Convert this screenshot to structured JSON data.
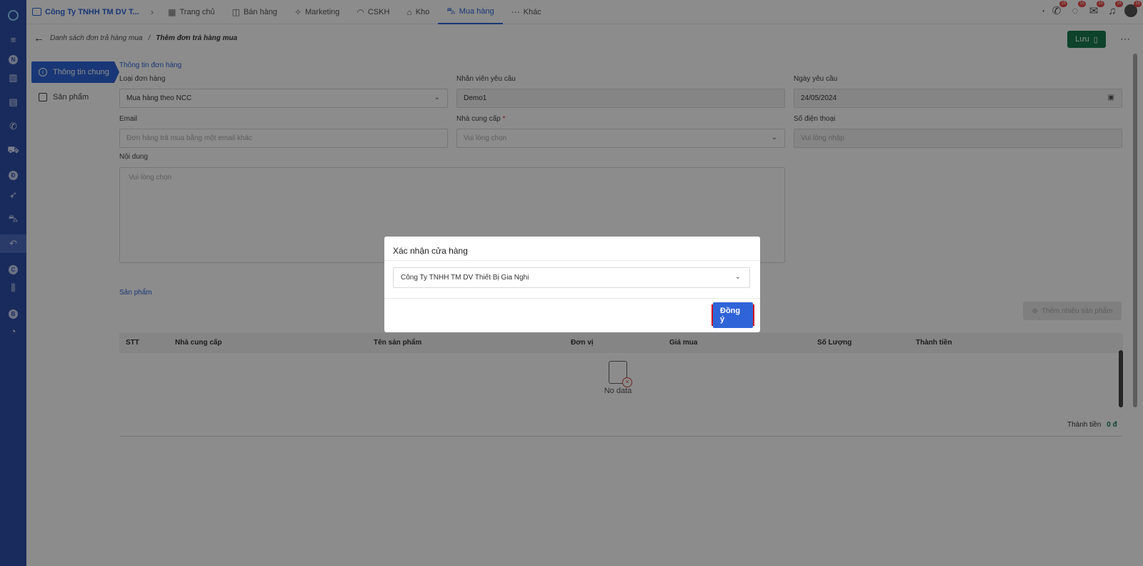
{
  "top_nav": {
    "store": "Công Ty TNHH TM DV T...",
    "items": [
      {
        "label": "Trang chủ",
        "icon": "chart-icon"
      },
      {
        "label": "Bán hàng",
        "icon": "box-icon"
      },
      {
        "label": "Marketing",
        "icon": "megaphone-icon"
      },
      {
        "label": "CSKH",
        "icon": "handshake-icon"
      },
      {
        "label": "Kho",
        "icon": "warehouse-icon"
      },
      {
        "label": "Mua hàng",
        "icon": "cart-icon"
      },
      {
        "label": "Khác",
        "icon": "dots-icon"
      }
    ],
    "badges": [
      "15",
      "15",
      "15",
      "15",
      "15"
    ]
  },
  "breadcrumb": {
    "parent": "Danh sách đơn trả hàng mua",
    "separator": "/",
    "current": "Thêm đơn trả hàng mua"
  },
  "save_label": "Lưu",
  "side_tabs": [
    "Thông tin chung",
    "Sản phẩm"
  ],
  "sidebar_letters": [
    "N",
    "Đ",
    "C",
    "B"
  ],
  "form": {
    "section_title": "Thông tin đơn hàng",
    "order_type": {
      "label": "Loại đơn hàng",
      "value": "Mua hàng theo NCC"
    },
    "requester": {
      "label": "Nhân viên yêu cầu",
      "value": "Demo1"
    },
    "request_date": {
      "label": "Ngày yêu cầu",
      "value": "24/05/2024"
    },
    "email": {
      "label": "Email",
      "placeholder": "Đơn hàng trả mua bằng một email khác"
    },
    "supplier": {
      "label": "Nhà cung cấp",
      "required": "*",
      "placeholder": "Vui lòng chọn"
    },
    "phone": {
      "label": "Số điện thoại",
      "placeholder": "Vui lòng nhập"
    },
    "content": {
      "label": "Nội dung",
      "placeholder": "Vui lòng chọn"
    }
  },
  "products": {
    "section_title": "Sản phẩm",
    "add_many": "Thêm nhiều sản phẩm",
    "columns": [
      "STT",
      "Nhà cung cấp",
      "Tên sản phẩm",
      "Đơn vị",
      "Giá mua",
      "Số Lượng",
      "Thành tiền"
    ],
    "empty": "No data",
    "total_label": "Thành tiền",
    "total_value": "0 đ"
  },
  "modal": {
    "title": "Xác nhận cửa hàng",
    "store_value": "Công Ty TNHH TM DV Thiết Bị Gia Nghi",
    "ok_label": "Đồng ý"
  }
}
